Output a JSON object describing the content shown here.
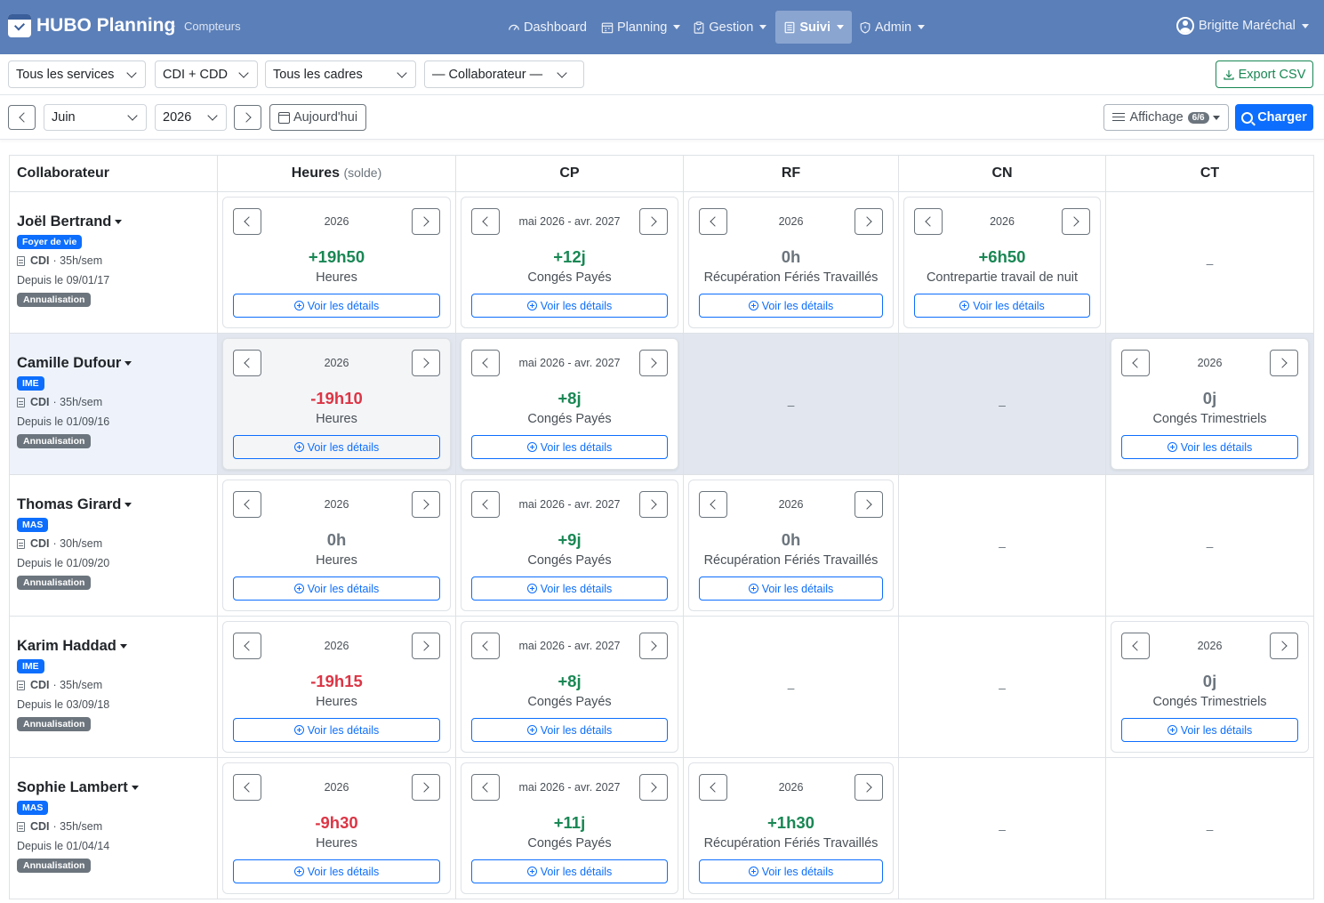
{
  "app": {
    "title": "HUBO Planning",
    "breadcrumb": "Compteurs"
  },
  "nav": {
    "items": [
      {
        "label": "Dashboard",
        "icon": "speedometer-icon"
      },
      {
        "label": "Planning",
        "icon": "calendar-icon"
      },
      {
        "label": "Gestion",
        "icon": "clipboard-icon"
      },
      {
        "label": "Suivi",
        "icon": "list-icon",
        "active": true
      },
      {
        "label": "Admin",
        "icon": "shield-icon"
      }
    ],
    "user": "Brigitte Maréchal"
  },
  "filters": {
    "service": "Tous les services",
    "contract": "CDI + CDD",
    "cadre": "Tous les cadres",
    "collaborator": "— Collaborateur —",
    "export_label": "Export CSV"
  },
  "period": {
    "month": "Juin",
    "year": "2026",
    "today_label": "Aujourd'hui",
    "display_label": "Affichage",
    "display_count": "6/6",
    "load_label": "Charger"
  },
  "table": {
    "headers": {
      "collaborator": "Collaborateur",
      "hours": "Heures",
      "hours_sub": "(solde)",
      "cp": "CP",
      "rf": "RF",
      "cn": "CN",
      "ct": "CT"
    },
    "details_label": "Voir les détails",
    "empty": "–",
    "rows": [
      {
        "name": "Joël Bertrand",
        "service": "Foyer de vie",
        "contract": "CDI",
        "hours_week": "· 35h/sem",
        "since": "Depuis le 09/01/17",
        "mode": "Annualisation",
        "hours": {
          "period": "2026",
          "value": "+19h50",
          "label": "Heures"
        },
        "cp": {
          "period": "mai 2026 - avr. 2027",
          "value": "+12j",
          "label": "Congés Payés"
        },
        "rf": {
          "period": "2026",
          "value": "0h",
          "label": "Récupération Fériés Travaillés"
        },
        "cn": {
          "period": "2026",
          "value": "+6h50",
          "label": "Contrepartie travail de nuit"
        }
      },
      {
        "name": "Camille Dufour",
        "service": "IME",
        "contract": "CDI",
        "hours_week": "· 35h/sem",
        "since": "Depuis le 01/09/16",
        "mode": "Annualisation",
        "hours": {
          "period": "2026",
          "value": "-19h10",
          "label": "Heures"
        },
        "cp": {
          "period": "mai 2026 - avr. 2027",
          "value": "+8j",
          "label": "Congés Payés"
        },
        "ct": {
          "period": "2026",
          "value": "0j",
          "label": "Congés Trimestriels"
        }
      },
      {
        "name": "Thomas Girard",
        "service": "MAS",
        "contract": "CDI",
        "hours_week": "· 30h/sem",
        "since": "Depuis le 01/09/20",
        "mode": "Annualisation",
        "hours": {
          "period": "2026",
          "value": "0h",
          "label": "Heures"
        },
        "cp": {
          "period": "mai 2026 - avr. 2027",
          "value": "+9j",
          "label": "Congés Payés"
        },
        "rf": {
          "period": "2026",
          "value": "0h",
          "label": "Récupération Fériés Travaillés"
        }
      },
      {
        "name": "Karim Haddad",
        "service": "IME",
        "contract": "CDI",
        "hours_week": "· 35h/sem",
        "since": "Depuis le 03/09/18",
        "mode": "Annualisation",
        "hours": {
          "period": "2026",
          "value": "-19h15",
          "label": "Heures"
        },
        "cp": {
          "period": "mai 2026 - avr. 2027",
          "value": "+8j",
          "label": "Congés Payés"
        },
        "ct": {
          "period": "2026",
          "value": "0j",
          "label": "Congés Trimestriels"
        }
      },
      {
        "name": "Sophie Lambert",
        "service": "MAS",
        "contract": "CDI",
        "hours_week": "· 35h/sem",
        "since": "Depuis le 01/04/14",
        "mode": "Annualisation",
        "hours": {
          "period": "2026",
          "value": "-9h30",
          "label": "Heures"
        },
        "cp": {
          "period": "mai 2026 - avr. 2027",
          "value": "+11j",
          "label": "Congés Payés"
        },
        "rf": {
          "period": "2026",
          "value": "+1h30",
          "label": "Récupération Fériés Travaillés"
        }
      }
    ]
  },
  "colors": {
    "navbar": "#5b7fb8",
    "primary": "#0d6efd",
    "positive": "#198754",
    "negative": "#dc3545",
    "neutral": "#6c757d"
  }
}
